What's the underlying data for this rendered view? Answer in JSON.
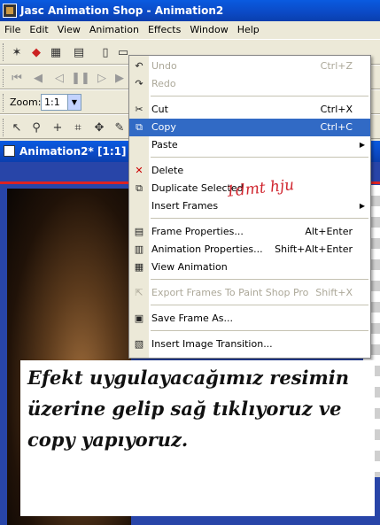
{
  "window": {
    "title": "Jasc Animation Shop - Animation2"
  },
  "menubar": {
    "items": [
      "File",
      "Edit",
      "View",
      "Animation",
      "Effects",
      "Window",
      "Help"
    ]
  },
  "zoom": {
    "label": "Zoom:",
    "value": "1:1"
  },
  "document": {
    "title": "Animation2* [1:1] -"
  },
  "context_menu": {
    "items": [
      {
        "label": "Undo",
        "shortcut": "Ctrl+Z",
        "icon": "undo-icon",
        "disabled": true
      },
      {
        "label": "Redo",
        "shortcut": "",
        "icon": "redo-icon",
        "disabled": true
      },
      {
        "label": "Cut",
        "shortcut": "Ctrl+X",
        "icon": "scissors-icon"
      },
      {
        "label": "Copy",
        "shortcut": "Ctrl+C",
        "icon": "copy-icon",
        "highlighted": true
      },
      {
        "label": "Paste",
        "shortcut": "",
        "icon": "",
        "submenu": true
      },
      {
        "label": "Delete",
        "shortcut": "",
        "icon": "delete-x-icon"
      },
      {
        "label": "Duplicate Selected",
        "shortcut": "",
        "icon": "duplicate-icon"
      },
      {
        "label": "Insert Frames",
        "shortcut": "",
        "icon": "",
        "submenu": true
      },
      {
        "label": "Frame Properties...",
        "shortcut": "Alt+Enter",
        "icon": "frame-properties-icon"
      },
      {
        "label": "Animation Properties...",
        "shortcut": "Shift+Alt+Enter",
        "icon": "animation-properties-icon"
      },
      {
        "label": "View Animation",
        "shortcut": "",
        "icon": "film-icon"
      },
      {
        "label": "Export Frames To Paint Shop Pro",
        "shortcut": "Shift+X",
        "icon": "export-icon",
        "disabled": true
      },
      {
        "label": "Save Frame As...",
        "shortcut": "",
        "icon": "save-frame-icon"
      },
      {
        "label": "Insert Image Transition...",
        "shortcut": "",
        "icon": "transition-icon"
      }
    ]
  },
  "watermark": "1dmt hju",
  "caption": "Efekt uygulayacağımız resimin üzerine gelip sağ tıklıyoruz ve copy yapıyoruz.",
  "colors": {
    "titlebar": "#0b49c4",
    "menu_highlight": "#316ac5",
    "watermark": "#d0262f",
    "canvas_border": "#2845a8"
  }
}
